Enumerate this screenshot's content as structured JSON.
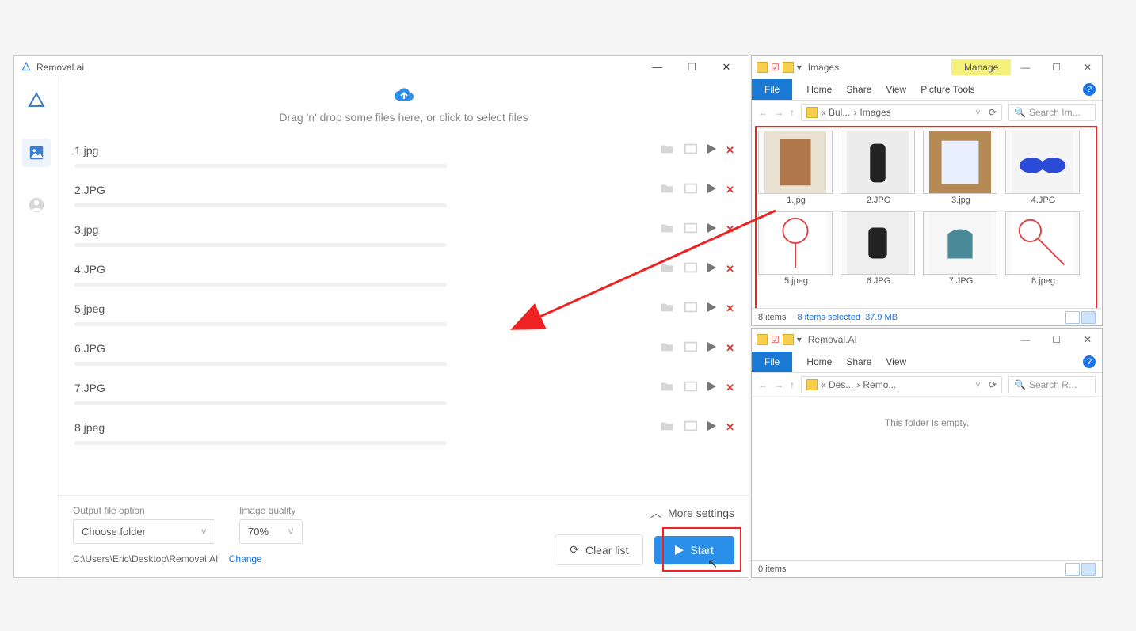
{
  "app": {
    "title": "Removal.ai",
    "dropzone_hint": "Drag 'n' drop some files here, or click to select files",
    "files": [
      {
        "name": "1.jpg"
      },
      {
        "name": "2.JPG"
      },
      {
        "name": "3.jpg"
      },
      {
        "name": "4.JPG"
      },
      {
        "name": "5.jpeg"
      },
      {
        "name": "6.JPG"
      },
      {
        "name": "7.JPG"
      },
      {
        "name": "8.jpeg"
      }
    ],
    "footer": {
      "output_label": "Output file option",
      "output_value": "Choose folder",
      "quality_label": "Image quality",
      "quality_value": "70%",
      "output_path": "C:\\Users\\Eric\\Desktop\\Removal.AI",
      "change_label": "Change",
      "more_settings": "More settings",
      "clear_list": "Clear list",
      "start": "Start"
    }
  },
  "explorer_top": {
    "title": "Images",
    "manage": "Manage",
    "picture_tools": "Picture Tools",
    "tabs": {
      "file": "File",
      "home": "Home",
      "share": "Share",
      "view": "View"
    },
    "breadcrumb": {
      "a": "« Bul...",
      "sep": "›",
      "b": "Images"
    },
    "search_placeholder": "Search Im...",
    "thumbs": [
      {
        "name": "1.jpg"
      },
      {
        "name": "2.JPG"
      },
      {
        "name": "3.jpg"
      },
      {
        "name": "4.JPG"
      },
      {
        "name": "5.jpeg"
      },
      {
        "name": "6.JPG"
      },
      {
        "name": "7.JPG"
      },
      {
        "name": "8.jpeg"
      }
    ],
    "status": {
      "items": "8 items",
      "selected": "8 items selected",
      "size": "37.9 MB"
    }
  },
  "explorer_bottom": {
    "title": "Removal.AI",
    "tabs": {
      "file": "File",
      "home": "Home",
      "share": "Share",
      "view": "View"
    },
    "breadcrumb": {
      "a": "« Des...",
      "sep": "›",
      "b": "Remo..."
    },
    "search_placeholder": "Search R...",
    "empty": "This folder is empty.",
    "status": {
      "items": "0 items"
    }
  }
}
